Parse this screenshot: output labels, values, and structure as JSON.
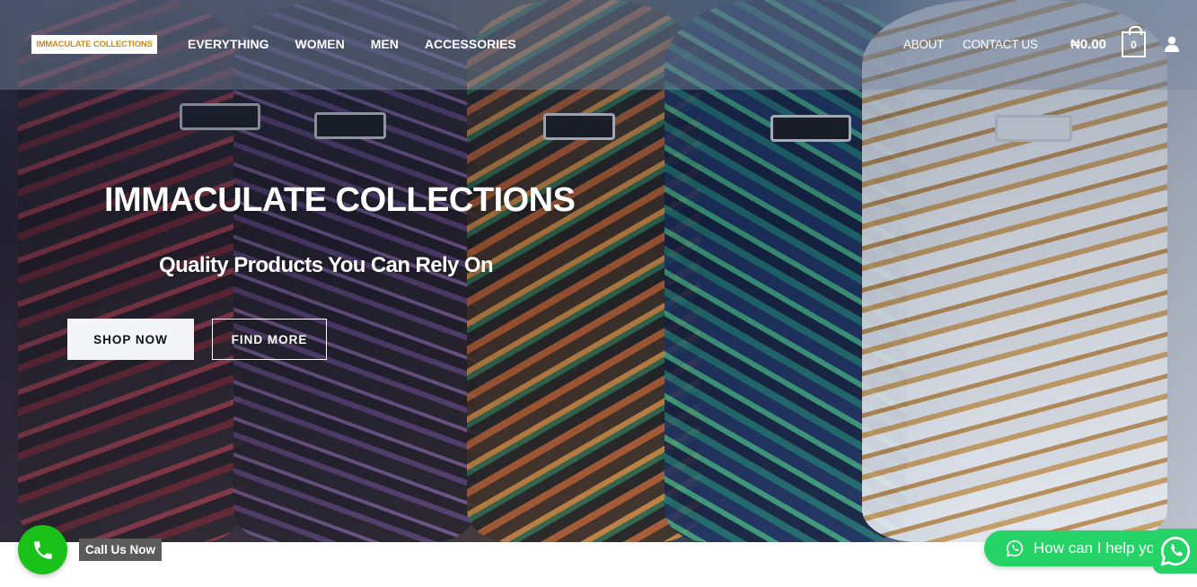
{
  "brand": {
    "logo_text": "IMMACULATE COLLECTIONS"
  },
  "nav": {
    "left": [
      "EVERYTHING",
      "WOMEN",
      "MEN",
      "ACCESSORIES"
    ],
    "right": [
      "ABOUT",
      "CONTACT US"
    ],
    "cart_amount": "₦0.00",
    "cart_count": "0"
  },
  "hero": {
    "title": "IMMACULATE COLLECTIONS",
    "subtitle": "Quality Products You Can Rely On",
    "shop_button": "SHOP NOW",
    "find_button": "FIND MORE"
  },
  "call": {
    "label": "Call Us Now"
  },
  "whatsapp": {
    "chat_text": "How can I help you?"
  },
  "colors": {
    "brand_gold": "#c78a1e",
    "call_green": "#19c119",
    "whatsapp_green": "#25d366"
  },
  "icons": {
    "cart": "cart-icon",
    "user": "user-icon",
    "phone": "phone-icon",
    "whatsapp": "whatsapp-icon"
  }
}
